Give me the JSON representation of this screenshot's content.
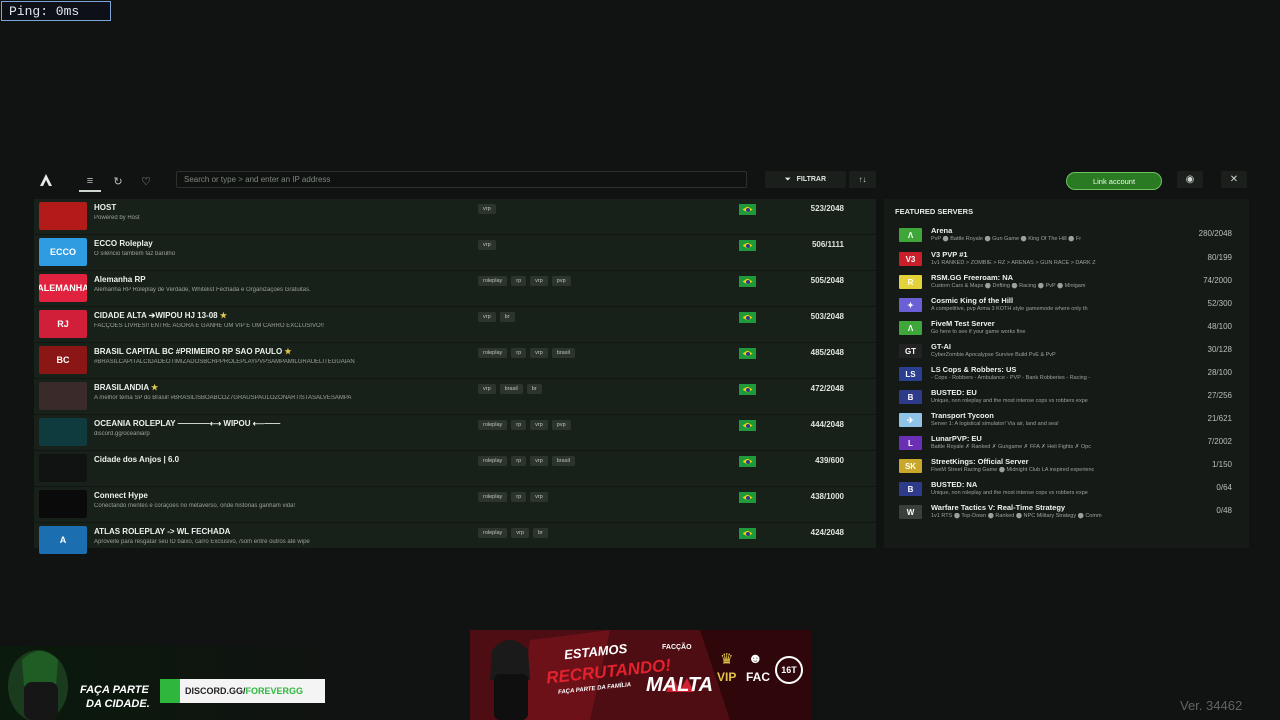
{
  "ping": "Ping: 0ms",
  "toolbar": {
    "search_placeholder": "Search or type > and enter an IP address",
    "filter_label": "FILTRAR",
    "link_account_label": "Link account"
  },
  "servers": [
    {
      "name": "HOST",
      "desc": "Powered by Host",
      "tags": [
        "vrp"
      ],
      "players": "523/2048",
      "thumb_bg": "#b31a1a",
      "thumb_text": "",
      "star": false
    },
    {
      "name": "ECCO Roleplay",
      "desc": "O silêncio também faz barulho",
      "tags": [
        "vrp"
      ],
      "players": "506/1111",
      "thumb_bg": "#2f9be0",
      "thumb_text": "ECCO",
      "star": false
    },
    {
      "name": "Alemanha RP",
      "desc": "Alemanha RP Roleplay de Verdade, Whitelist Fechada e Organizações Gratuitas.",
      "tags": [
        "roleplay",
        "rp",
        "vrp",
        "pvp"
      ],
      "players": "505/2048",
      "thumb_bg": "#e0223e",
      "thumb_text": "ALEMANHA",
      "star": false
    },
    {
      "name": "CIDADE ALTA ➔WIPOU HJ 13-08",
      "desc": "FACÇÕES LIVRES!! ENTRE AGORA E GANHE UM VIP E UM CARRO EXCLUSIVO!!",
      "tags": [
        "vrp",
        "br"
      ],
      "players": "503/2048",
      "thumb_bg": "#d11f3a",
      "thumb_text": "RJ",
      "star": true
    },
    {
      "name": "BRASIL CAPITAL BC #PRIMEIRO RP SAO PAULO",
      "desc": "#BRASILCAPITALCIDADEOTIMIZADOSBCRPPROLEPLAYPVPSAMPAMILGRAUELITEGUAIAN",
      "tags": [
        "roleplay",
        "rp",
        "vrp",
        "brasil"
      ],
      "players": "485/2048",
      "thumb_bg": "#8b1616",
      "thumb_text": "BC",
      "star": true
    },
    {
      "name": "BRASILANDIA",
      "desc": "A melhor tema SP do Brasil! #BRASILISBOABCDZ7GRAUSPAULOZONARTISTASALVESAMPA",
      "tags": [
        "vrp",
        "brasil",
        "br"
      ],
      "players": "472/2048",
      "thumb_bg": "#3a2a2a",
      "thumb_text": "",
      "star": true
    },
    {
      "name": "OCEANIA ROLEPLAY ————⟷ WIPOU ⟵——",
      "desc": "discord.gg/oceaniarp",
      "tags": [
        "roleplay",
        "rp",
        "vrp",
        "pvp"
      ],
      "players": "444/2048",
      "thumb_bg": "#0f3a3e",
      "thumb_text": "",
      "star": false
    },
    {
      "name": "Cidade dos Anjos | 6.0",
      "desc": "",
      "tags": [
        "roleplay",
        "rp",
        "vrp",
        "brasil"
      ],
      "players": "439/600",
      "thumb_bg": "#101311",
      "thumb_text": "",
      "star": false
    },
    {
      "name": "Connect Hype",
      "desc": "Conectando mentes e corações no metaverso, onde histórias ganham vida!",
      "tags": [
        "roleplay",
        "rp",
        "vrp"
      ],
      "players": "438/1000",
      "thumb_bg": "#0a0a0a",
      "thumb_text": "",
      "star": false
    },
    {
      "name": "ATLAS ROLEPLAY -> WL FECHADA",
      "desc": "Aproveite para resgatar seu ID baixo, carro Exclusivo, /som entre outros até wipe",
      "tags": [
        "roleplay",
        "vrp",
        "br"
      ],
      "players": "424/2048",
      "thumb_bg": "#1b6fb0",
      "thumb_text": "A",
      "star": false
    }
  ],
  "featured": {
    "title": "FEATURED SERVERS",
    "items": [
      {
        "name": "Arena",
        "desc": "PvP ⬤ Battle Royale ⬤ Gun Game ⬤ King Of The Hill ⬤ Fr",
        "players": "280/2048",
        "icon_bg": "#3fa73a",
        "icon_text": "Λ"
      },
      {
        "name": "V3 PVP #1",
        "desc": "1v1 RANKED > ZOMBIE > RZ > ARENAS > GUN RACE > DARK Z",
        "players": "80/199",
        "icon_bg": "#c81f2a",
        "icon_text": "V3"
      },
      {
        "name": "RSM.GG Freeroam: NA",
        "desc": "Custom Cars & Maps ⬤ Drifting ⬤ Racing ⬤ PvP ⬤ Minigam",
        "players": "74/2000",
        "icon_bg": "#e3d23a",
        "icon_text": "R"
      },
      {
        "name": "Cosmic King of the Hill",
        "desc": "A competitive, pvp Arma 3 KOTH style gamemode where only th",
        "players": "52/300",
        "icon_bg": "#6b5fd6",
        "icon_text": "✦"
      },
      {
        "name": "FiveM Test Server",
        "desc": "Go here to see if your game works fine",
        "players": "48/100",
        "icon_bg": "#3fa73a",
        "icon_text": "Λ"
      },
      {
        "name": "GT-AI",
        "desc": "CyberZombie Apocalypse Survive Build PvE & PvP",
        "players": "30/128",
        "icon_bg": "#222",
        "icon_text": "GT"
      },
      {
        "name": "LS Cops & Robbers: US",
        "desc": "- Cops - Robbers - Ambulance - PVP - Bank Robberies - Racing -",
        "players": "28/100",
        "icon_bg": "#2a3f8f",
        "icon_text": "LS"
      },
      {
        "name": "BUSTED: EU",
        "desc": "Unique, non roleplay and the most intense cops vs robbers expe",
        "players": "27/256",
        "icon_bg": "#2d3b8a",
        "icon_text": "B"
      },
      {
        "name": "Transport Tycoon",
        "desc": "Server 1: A logistical simulator! Via air, land and sea!",
        "players": "21/621",
        "icon_bg": "#8fc4e8",
        "icon_text": "✈"
      },
      {
        "name": "LunarPVP: EU",
        "desc": "Battle Royale ✗ Ranked ✗ Gungame ✗ FFA ✗ Heli Fights ✗ Opc",
        "players": "7/2002",
        "icon_bg": "#6a2fb5",
        "icon_text": "L"
      },
      {
        "name": "StreetKings: Official Server",
        "desc": "FiveM Street Racing Game ⬤ Midnight Club LA inspired experienc",
        "players": "1/150",
        "icon_bg": "#c9a72a",
        "icon_text": "SK"
      },
      {
        "name": "BUSTED: NA",
        "desc": "Unique, non roleplay and the most intense cops vs robbers expe",
        "players": "0/64",
        "icon_bg": "#2d3b8a",
        "icon_text": "B"
      },
      {
        "name": "Warfare Tactics V: Real-Time Strategy",
        "desc": "1v1 RTS ⬤ Top-Down ⬤ Ranked ⬤ NPC Military Strategy ⬤ Comm",
        "players": "0/48",
        "icon_bg": "#3b3f3c",
        "icon_text": "W"
      }
    ]
  },
  "promo_left": {
    "line1": "FAÇA PARTE",
    "line2": "DA CIDADE.",
    "url_a": "DISCORD.GG/",
    "url_b": "FOREVERGG"
  },
  "promo_center": {
    "title1": "ESTAMOS",
    "title2": "RECRUTANDO!",
    "subtitle": "FAÇA PARTE DA FAMÍLIA",
    "faccao": "FACÇÃO",
    "malta": "MALTA",
    "vip": "VIP",
    "fac": "FAC",
    "age": "16T"
  },
  "version": "Ver. 34462",
  "colors": {
    "accent_green": "#2a7a23",
    "panel_bg": "#172019",
    "bg": "#101311"
  }
}
